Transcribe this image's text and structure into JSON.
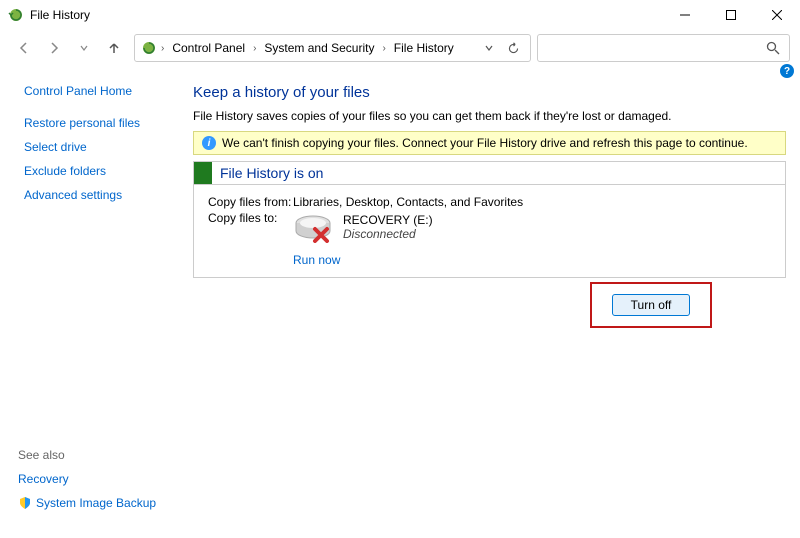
{
  "window": {
    "title": "File History"
  },
  "breadcrumb": {
    "items": [
      "Control Panel",
      "System and Security",
      "File History"
    ]
  },
  "sidebar": {
    "home": "Control Panel Home",
    "links": [
      "Restore personal files",
      "Select drive",
      "Exclude folders",
      "Advanced settings"
    ],
    "see_also_label": "See also",
    "bottom_links": [
      "Recovery",
      "System Image Backup"
    ]
  },
  "main": {
    "title": "Keep a history of your files",
    "description": "File History saves copies of your files so you can get them back if they're lost or damaged.",
    "warning": "We can't finish copying your files. Connect your File History drive and refresh this page to continue.",
    "status_title": "File History is on",
    "copy_from_label": "Copy files from:",
    "copy_from_value": "Libraries, Desktop, Contacts, and Favorites",
    "copy_to_label": "Copy files to:",
    "drive_name": "RECOVERY (E:)",
    "drive_status": "Disconnected",
    "run_now": "Run now",
    "turn_off": "Turn off"
  }
}
